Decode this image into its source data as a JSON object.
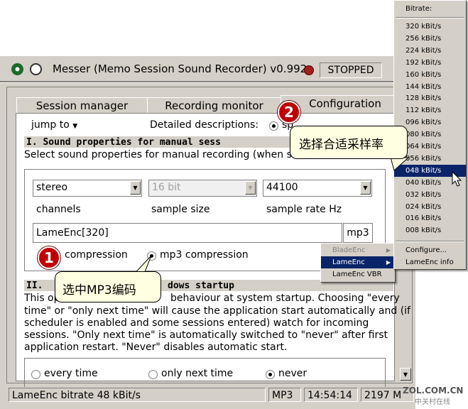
{
  "window": {
    "title": "Messer (Memo Session Sound Recorder) v0.992",
    "state": "STOPPED"
  },
  "tabs": [
    "Session manager",
    "Recording monitor",
    "Configuration"
  ],
  "toolbar": {
    "jump_to": "jump to",
    "detailed_descriptions": "Detailed descriptions:",
    "option_fragment": "sp"
  },
  "section1": {
    "heading": "I. Sound properties for manual sess",
    "desc": "Select sound properties for manual recording (when sche",
    "channels_value": "stereo",
    "channels_label": "channels",
    "sample_size_value": "16 bit",
    "sample_size_label": "sample size",
    "sample_rate_value": "44100",
    "sample_rate_label": "sample rate Hz",
    "encoder_value": "LameEnc[320]",
    "encoder_button": "mp3",
    "radio_compression": "compression",
    "radio_mp3": "mp3 compression"
  },
  "section2": {
    "heading_start": "II.",
    "heading_end": "dows startup",
    "line1_start": "This op",
    "line1_end": "behaviour at system startup. Choosing \"every",
    "line2": "time\" or \"only next time\" will cause the application start automatically and  (if",
    "line3": "scheduler is enabled and some sessions entered) watch for incoming",
    "line4": "sessions. \"Only next time\" is automatically switched to \"never\" after first",
    "line5": "application restart. \"Never\" disables automatic start.",
    "opt_every": "every time",
    "opt_next": "only next time",
    "opt_never": "never"
  },
  "statusbar": {
    "bitrate": "LameEnc bitrate 48 kBit/s",
    "format": "MP3",
    "time": "14:54:14",
    "size": "2197 M"
  },
  "encoder_menu": {
    "items": [
      "BladeEnc",
      "LameEnc",
      "LameEnc VBR"
    ]
  },
  "bitrate_menu": {
    "header": "Bitrate:",
    "items": [
      "320 kBit/s",
      "256 kBit/s",
      "224 kBit/s",
      "192 kBit/s",
      "160 kBit/s",
      "144 kBit/s",
      "128 kBit/s",
      "112 kBit/s",
      "096 kBit/s",
      "080 kBit/s",
      "064 kBit/s",
      "056 kBit/s",
      "048 kBit/s",
      "040 kBit/s",
      "032 kBit/s",
      "024 kBit/s",
      "016 kBit/s",
      "008 kBit/s"
    ],
    "configure": "Configure...",
    "info": "LameEnc info"
  },
  "callouts": {
    "one_number": "1",
    "one_text": "选中MP3编码",
    "two_number": "2",
    "two_text": "选择合适采样率"
  },
  "watermark": {
    "site": "ZOL.COM.CN",
    "sub": "中关村在线"
  },
  "colors": {
    "selection": "#0a246a",
    "callout_red": "#c00000",
    "bubble": "#ffffe1"
  }
}
